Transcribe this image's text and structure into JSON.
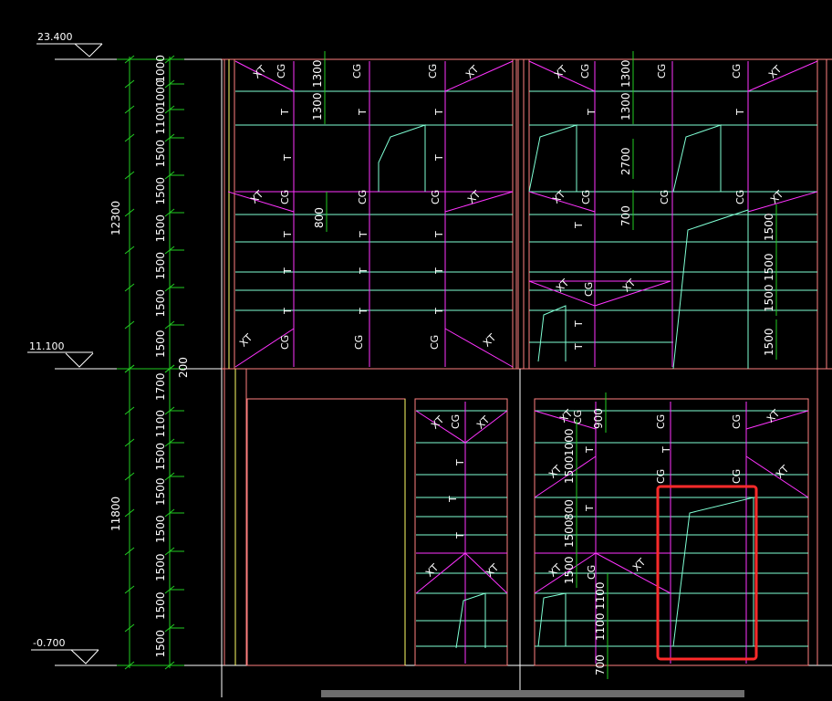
{
  "colors": {
    "background": "#000000",
    "dimension_line": "#22cc22",
    "grid_line": "#7fffd4",
    "beam_line": "#ff33ff",
    "frame_line": "#ff7f7f",
    "column_line": "#ffff66",
    "text": "#ffffff",
    "highlight_box": "#ff2a2a"
  },
  "levels": [
    "23.400",
    "11.100",
    "-0.700"
  ],
  "left_dimensions": {
    "upper_total": "12300",
    "lower_total": "11800",
    "upper": [
      "1000",
      "1000",
      "1100",
      "1500",
      "1500",
      "1500",
      "1500",
      "1500",
      "1500"
    ],
    "lower": [
      "1700",
      "1100",
      "1500",
      "1500",
      "1500",
      "1500",
      "1500",
      "1500"
    ],
    "gap": "200"
  },
  "panel_labels": {
    "brace": "XT",
    "tie": "CG",
    "truss": "T"
  },
  "inner_dimensions": [
    "1300",
    "1300",
    "800",
    "1300",
    "1300",
    "2700",
    "700",
    "1500",
    "1500",
    "1500",
    "1500",
    "900",
    "1000",
    "1500",
    "1500",
    "800",
    "1500",
    "1100",
    "1100",
    "700"
  ],
  "scrollbar": {
    "label": ""
  }
}
